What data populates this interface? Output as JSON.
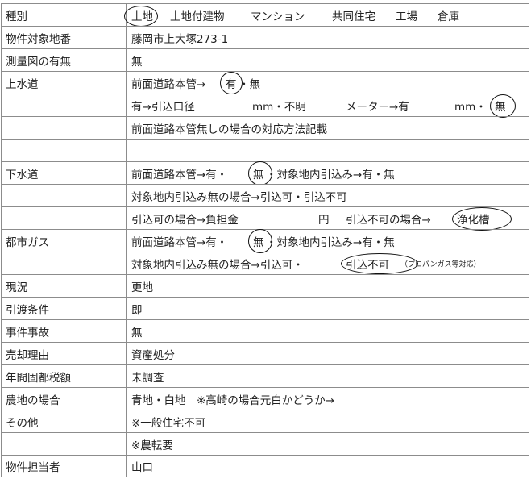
{
  "rows": [
    {
      "label": "種別",
      "parts": [
        "土地",
        "土地付建物",
        "マンション",
        "共同住宅",
        "工場",
        "倉庫"
      ]
    },
    {
      "label": "物件対象地番",
      "value": "藤岡市上大塚273-1"
    },
    {
      "label": "測量図の有無",
      "value": "無"
    },
    {
      "label": "上水道",
      "parts": [
        "前面道路本管→",
        "有",
        "・無"
      ]
    },
    {
      "label": "",
      "parts": [
        "有→引込口径",
        "mm・不明",
        "メーター→有",
        "mm・",
        "無"
      ]
    },
    {
      "label": "",
      "value": "前面道路本管無しの場合の対応方法記載"
    },
    {
      "label": "",
      "value": ""
    },
    {
      "label": "下水道",
      "parts": [
        "前面道路本管→有・",
        "無",
        "・対象地内引込み→有・無"
      ]
    },
    {
      "label": "",
      "value": "対象地内引込み無の場合→引込可・引込不可"
    },
    {
      "label": "",
      "parts": [
        "引込可の場合→負担金",
        "円",
        "引込不可の場合→",
        "浄化槽"
      ]
    },
    {
      "label": "都市ガス",
      "parts": [
        "前面道路本管→有・",
        "無",
        "・対象地内引込み→有・無"
      ]
    },
    {
      "label": "",
      "parts": [
        "対象地内引込み無の場合→引込可・",
        "引込不可",
        "（プロパンガス等対応）"
      ]
    },
    {
      "label": "現況",
      "value": "更地"
    },
    {
      "label": "引渡条件",
      "value": "即"
    },
    {
      "label": "事件事故",
      "value": "無"
    },
    {
      "label": "売却理由",
      "value": "資産処分"
    },
    {
      "label": "年間固都税額",
      "value": "未調査"
    },
    {
      "label": "農地の場合",
      "value": "青地・白地　※高崎の場合元白かどうか→"
    },
    {
      "label": "その他",
      "value": "※一般住宅不可"
    },
    {
      "label": "",
      "value": "※農転要"
    },
    {
      "label": "物件担当者",
      "value": "山口"
    }
  ]
}
